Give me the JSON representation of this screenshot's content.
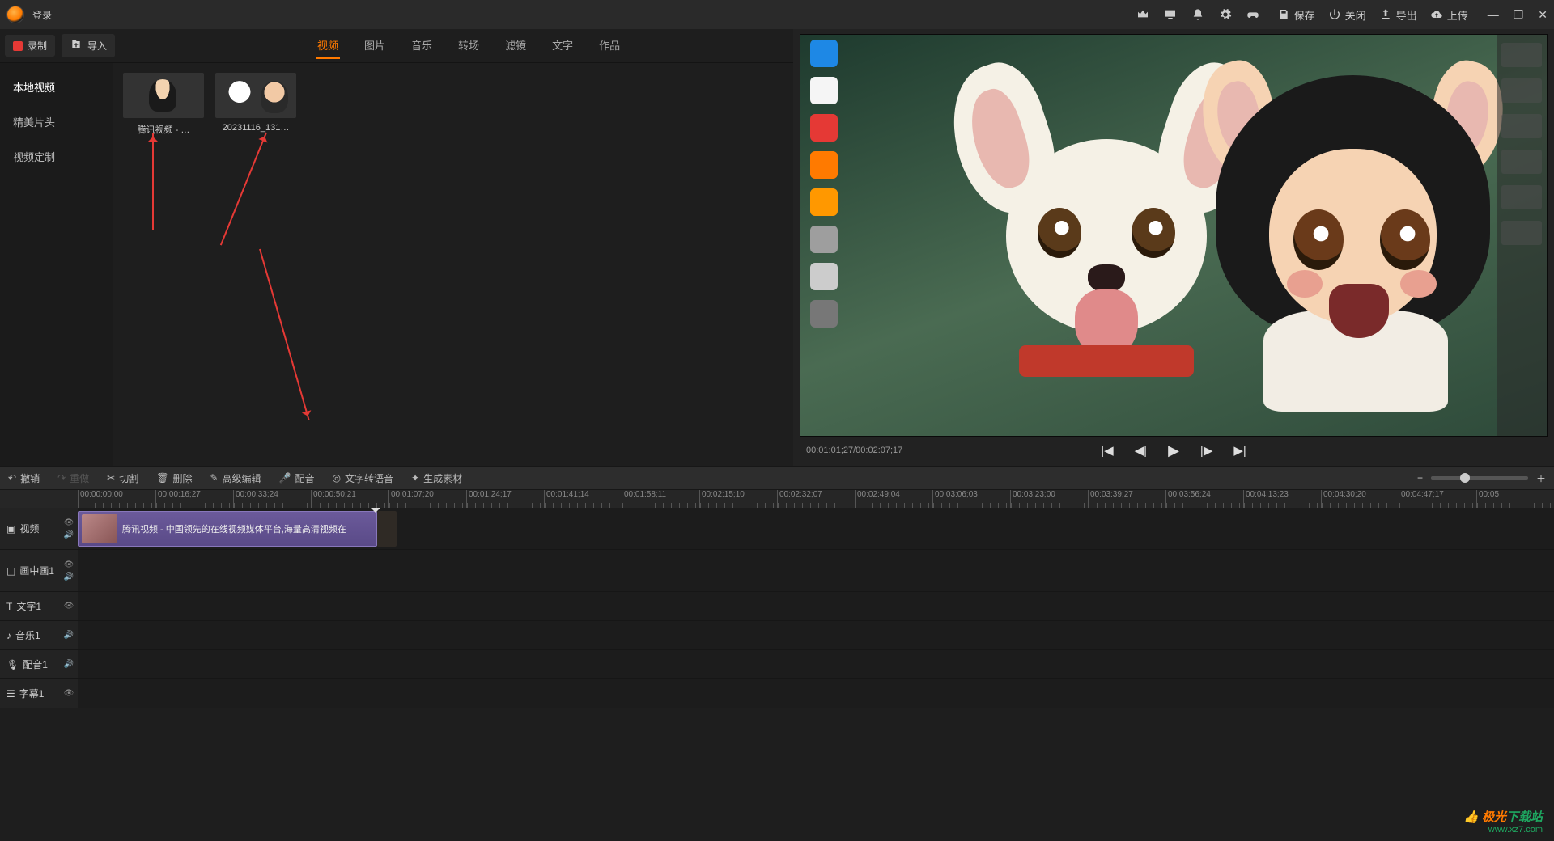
{
  "titlebar": {
    "login": "登录",
    "save": "保存",
    "close": "关闭",
    "export": "导出",
    "upload": "上传"
  },
  "media": {
    "record": "录制",
    "import": "导入",
    "tabs": [
      "视频",
      "图片",
      "音乐",
      "转场",
      "滤镜",
      "文字",
      "作品"
    ],
    "active_tab": 0,
    "cats": [
      "本地视频",
      "精美片头",
      "视频定制"
    ],
    "thumbs": [
      {
        "label": "腾讯视频 - …"
      },
      {
        "label": "20231116_131…"
      }
    ]
  },
  "preview": {
    "timecode": "00:01:01;27/00:02:07;17"
  },
  "toolbar": {
    "undo": "撤销",
    "redo": "重做",
    "cut": "切割",
    "delete": "删除",
    "advanced": "高级编辑",
    "dub": "配音",
    "tts": "文字转语音",
    "gen": "生成素材"
  },
  "ruler": [
    "00:00:00;00",
    "00:00:16;27",
    "00:00:33;24",
    "00:00:50;21",
    "00:01:07;20",
    "00:01:24;17",
    "00:01:41;14",
    "00:01:58;11",
    "00:02:15;10",
    "00:02:32;07",
    "00:02:49;04",
    "00:03:06;03",
    "00:03:23;00",
    "00:03:39;27",
    "00:03:56;24",
    "00:04:13;23",
    "00:04:30;20",
    "00:04:47;17",
    "00:05"
  ],
  "tracks": {
    "video": "视频",
    "pip": "画中画1",
    "text": "文字1",
    "music": "音乐1",
    "voice": "配音1",
    "sub": "字幕1"
  },
  "clip": {
    "title": "腾讯视频 - 中国领先的在线视频媒体平台,海量高清视频在"
  },
  "watermark": {
    "l1a": "极光",
    "l1b": "下载站",
    "l2": "www.xz7.com"
  }
}
